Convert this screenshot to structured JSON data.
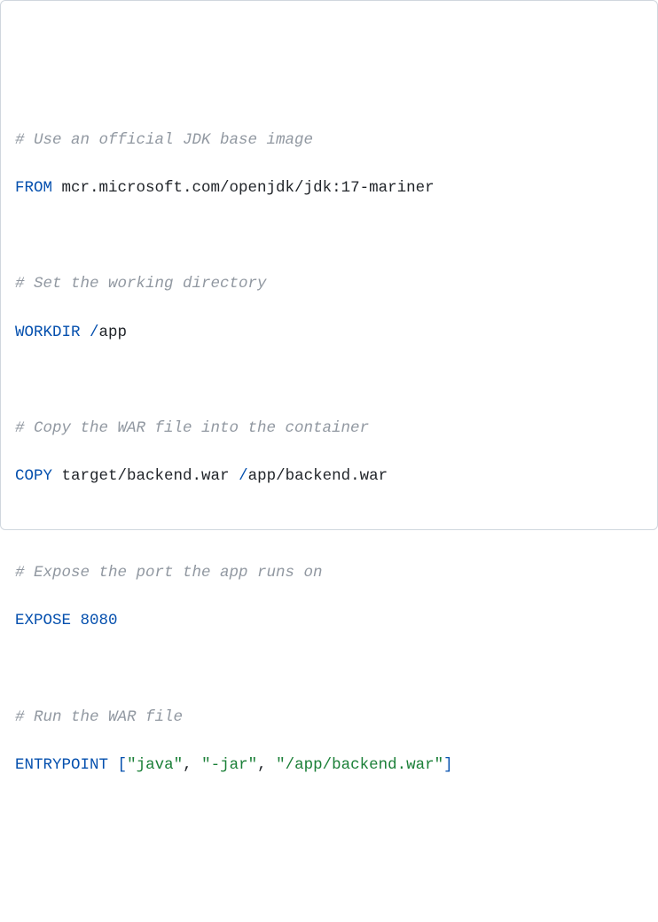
{
  "dockerfile": {
    "c1": "# Use an official JDK base image",
    "from_kw": "FROM",
    "from_img": " mcr.microsoft.com/openjdk/jdk:17-mariner",
    "c2": "# Set the working directory",
    "workdir_kw": "WORKDIR",
    "workdir_slash": " /",
    "workdir_val": "app",
    "c3": "# Copy the WAR file into the container",
    "copy_kw": "COPY",
    "copy_src": " target/backend.war ",
    "copy_slash": "/",
    "copy_dst": "app/backend.war",
    "c4": "# Expose the port the app runs on",
    "expose_kw": "EXPOSE",
    "expose_sp": " ",
    "expose_port": "8080",
    "c5": "# Run the WAR file",
    "ep_kw": "ENTRYPOINT",
    "ep_sp": " ",
    "ep_lb": "[",
    "ep_s1": "\"java\"",
    "ep_com1": ", ",
    "ep_s2": "\"-jar\"",
    "ep_com2": ", ",
    "ep_s3": "\"/app/backend.war\"",
    "ep_rb": "]"
  },
  "chart_data": {
    "type": "table",
    "title": "Dockerfile",
    "rows": [
      {
        "kind": "comment",
        "text": "# Use an official JDK base image"
      },
      {
        "kind": "FROM",
        "value": "mcr.microsoft.com/openjdk/jdk:17-mariner"
      },
      {
        "kind": "blank"
      },
      {
        "kind": "comment",
        "text": "# Set the working directory"
      },
      {
        "kind": "WORKDIR",
        "value": "/app"
      },
      {
        "kind": "blank"
      },
      {
        "kind": "comment",
        "text": "# Copy the WAR file into the container"
      },
      {
        "kind": "COPY",
        "src": "target/backend.war",
        "dst": "/app/backend.war"
      },
      {
        "kind": "blank"
      },
      {
        "kind": "comment",
        "text": "# Expose the port the app runs on"
      },
      {
        "kind": "EXPOSE",
        "value": 8080
      },
      {
        "kind": "blank"
      },
      {
        "kind": "comment",
        "text": "# Run the WAR file"
      },
      {
        "kind": "ENTRYPOINT",
        "value": [
          "java",
          "-jar",
          "/app/backend.war"
        ]
      }
    ]
  }
}
